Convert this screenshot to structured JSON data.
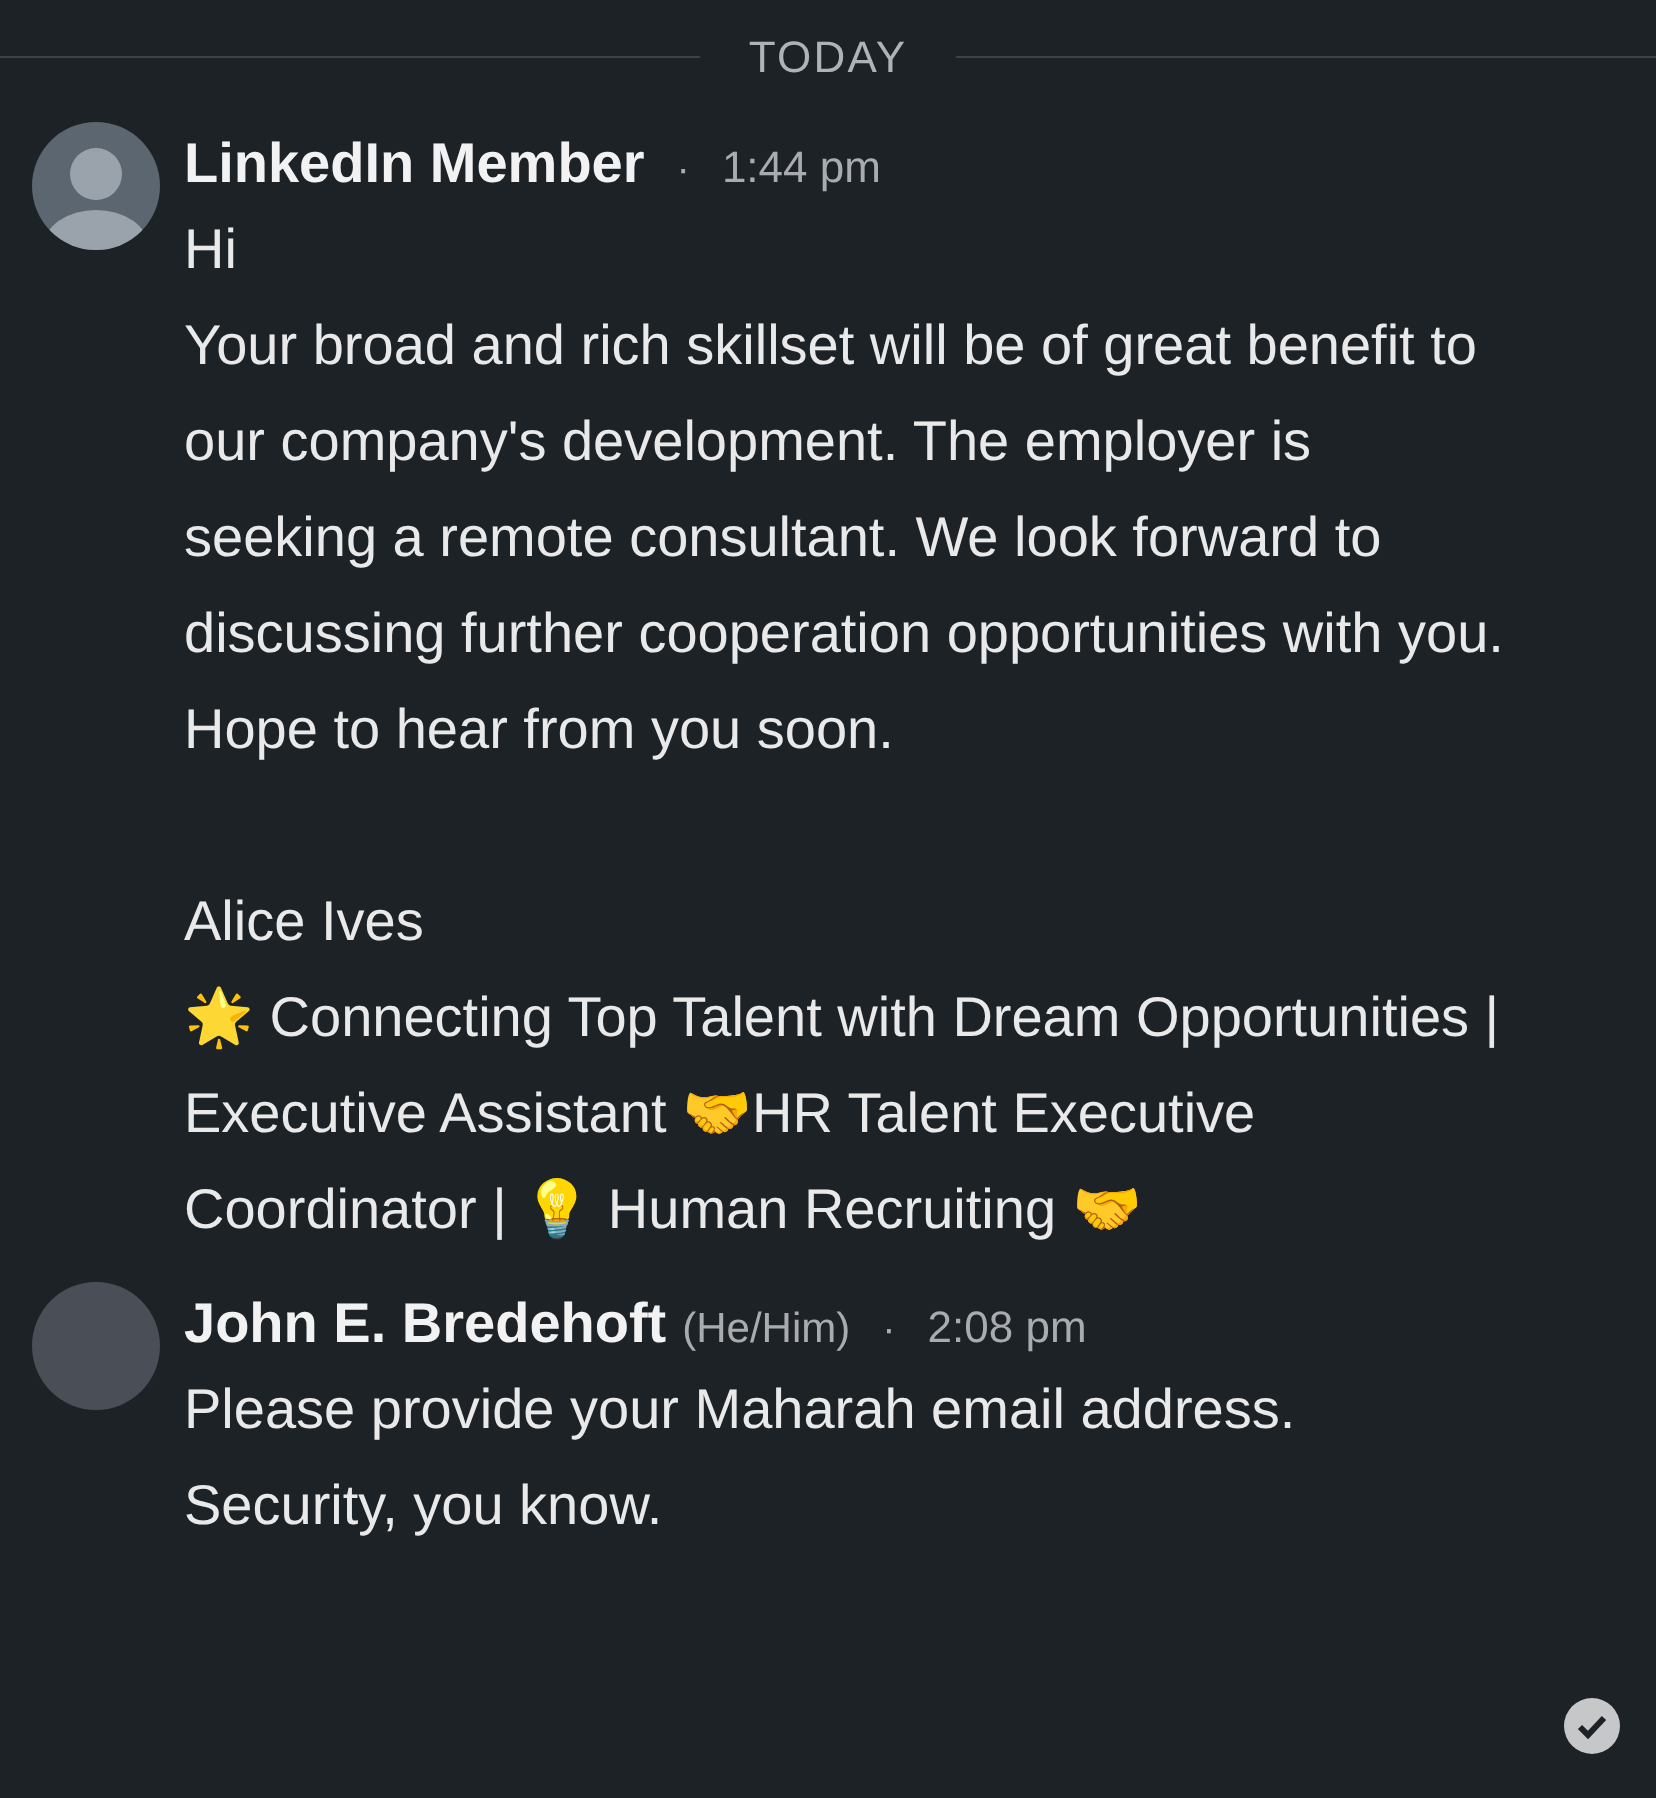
{
  "divider": {
    "label": "TODAY"
  },
  "messages": [
    {
      "avatar": {
        "kind": "silhouette"
      },
      "sender": "LinkedIn Member",
      "separator": "·",
      "time": "1:44 pm",
      "paragraphs": [
        [
          "Hi",
          "Your broad and rich skillset will be of great benefit to our company's development. The employer is seeking a remote consultant. We look forward to discussing further cooperation opportunities with you. Hope to hear from you soon."
        ],
        [
          "Alice Ives",
          "🌟 Connecting Top Talent with Dream Opportunities | Executive Assistant 🤝HR Talent Executive Coordinator | 💡 Human Recruiting 🤝"
        ]
      ]
    },
    {
      "avatar": {
        "kind": "photo"
      },
      "sender": "John E. Bredehoft",
      "pronouns": "(He/Him)",
      "separator": "·",
      "time": "2:08 pm",
      "paragraphs": [
        [
          "Please provide your Maharah email address. Security, you know."
        ]
      ],
      "read": true
    }
  ]
}
